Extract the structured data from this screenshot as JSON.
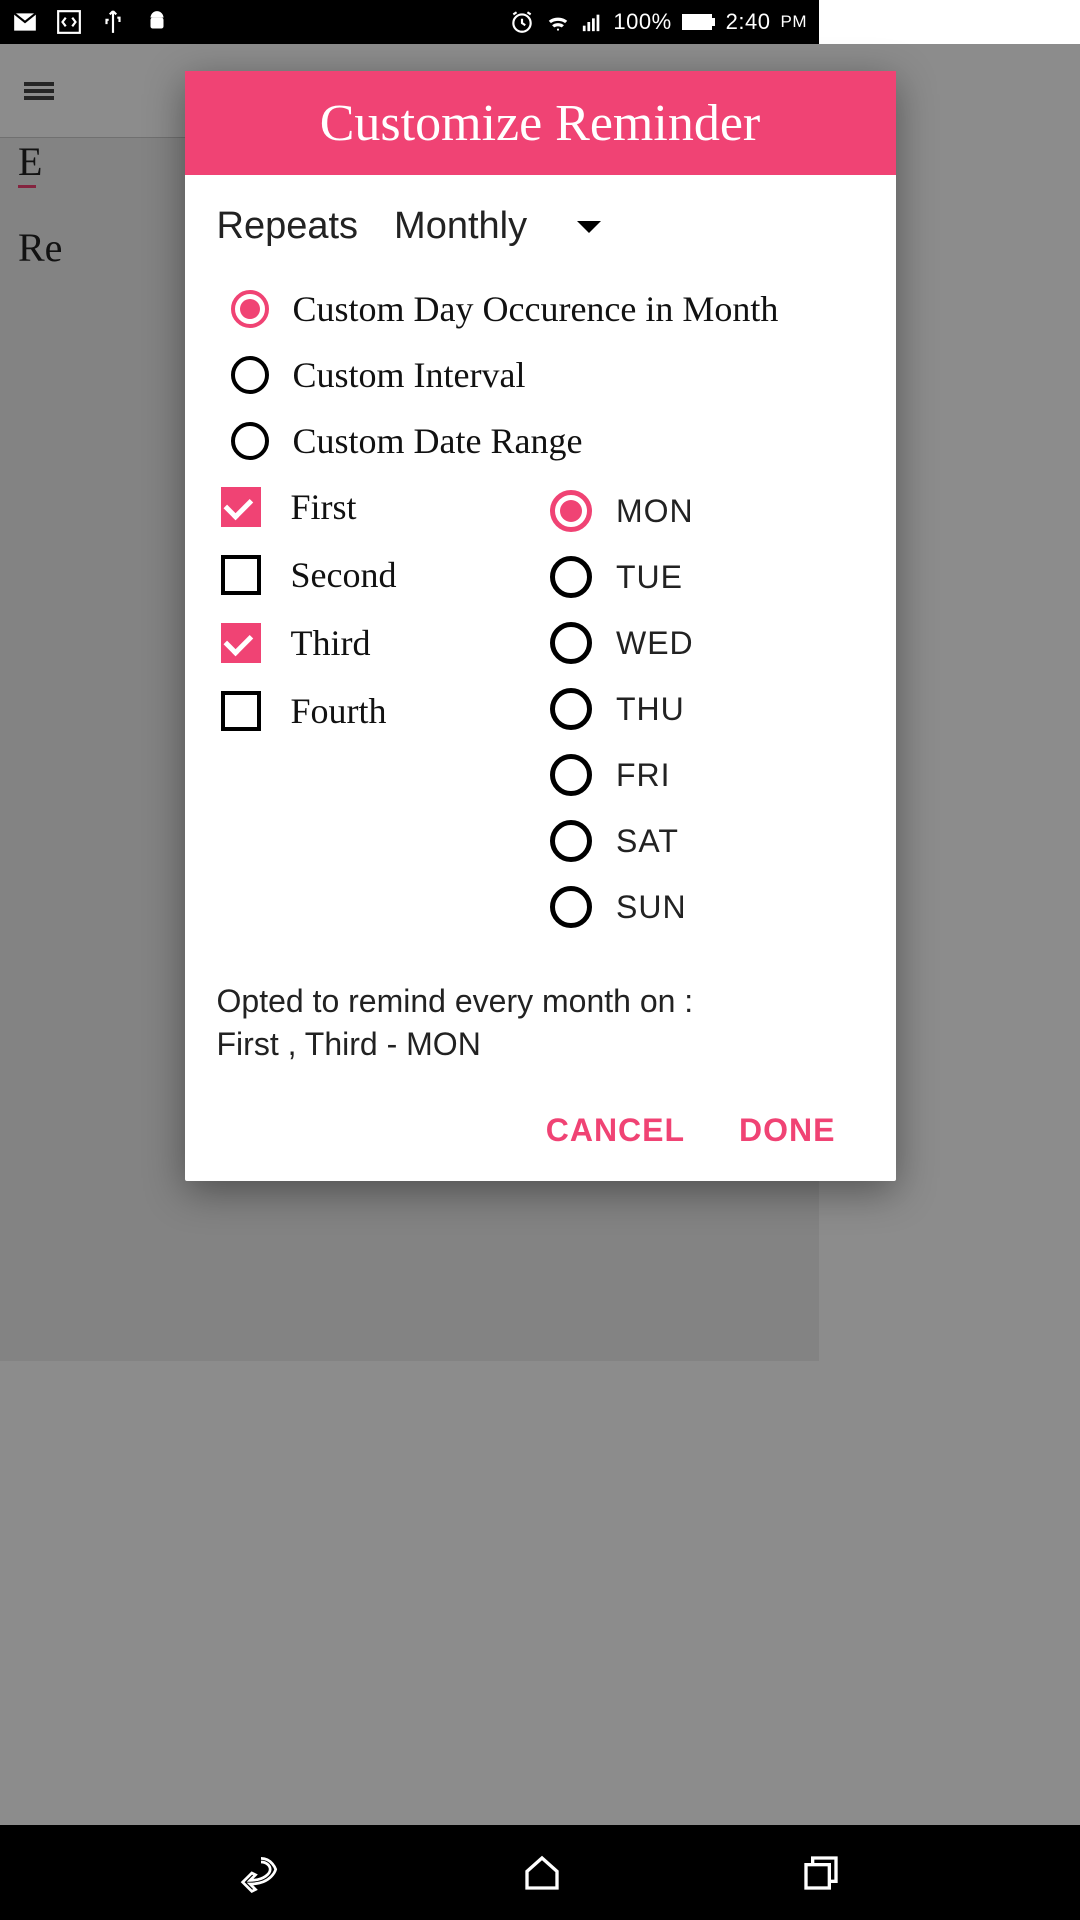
{
  "status": {
    "battery": "100%",
    "time": "2:40",
    "ampm": "PM"
  },
  "dialog": {
    "title": "Customize Reminder",
    "repeats_label": "Repeats",
    "repeats_value": "Monthly",
    "options": {
      "opt1": "Custom Day Occurence in Month",
      "opt2": "Custom Interval",
      "opt3": "Custom Date Range"
    },
    "occurrences": {
      "first": "First",
      "second": "Second",
      "third": "Third",
      "fourth": "Fourth"
    },
    "days": {
      "mon": "MON",
      "tue": "TUE",
      "wed": "WED",
      "thu": "THU",
      "fri": "FRI",
      "sat": "SAT",
      "sun": "SUN"
    },
    "summary_line1": "Opted to remind every month on :",
    "summary_line2": "First , Third  -  MON",
    "cancel": "CANCEL",
    "done": "DONE"
  }
}
